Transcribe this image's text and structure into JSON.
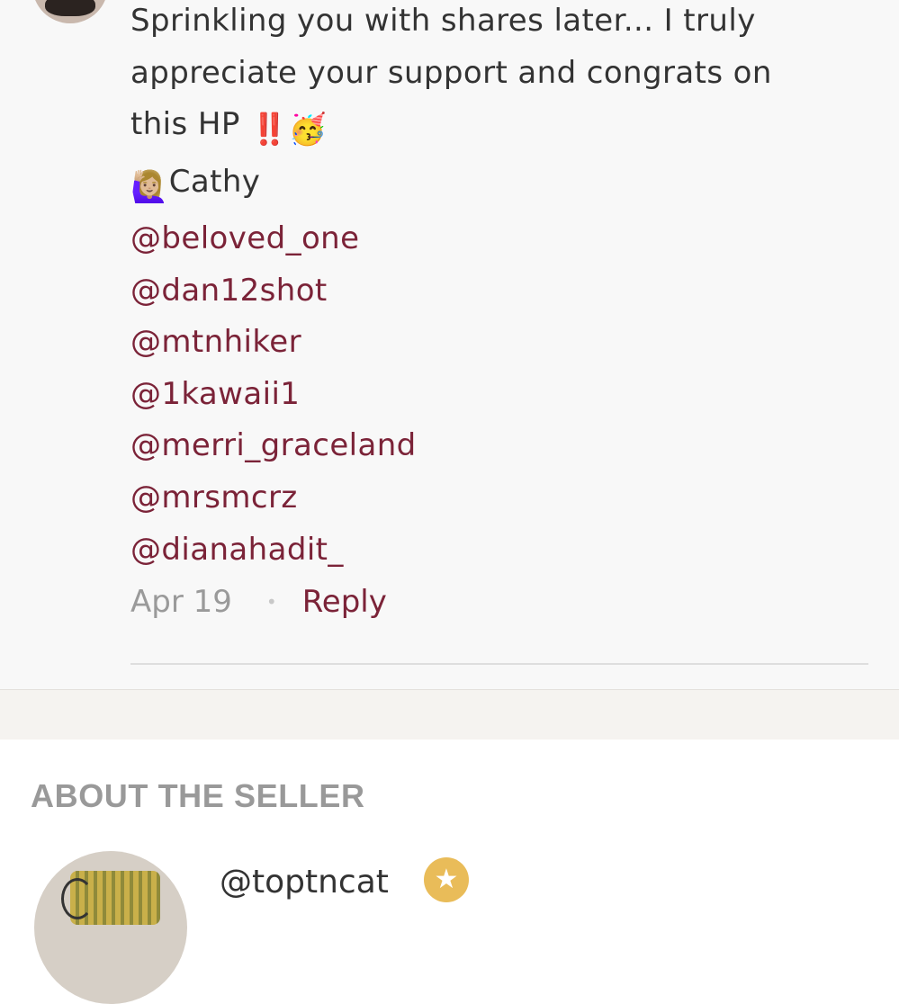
{
  "comment": {
    "line1": "Sprinkling you with shares later... I truly",
    "line2": "appreciate your support and congrats on",
    "line3": "this HP",
    "line3_emoji": "‼️🥳",
    "signoff_emoji": "🙋🏼‍♀️",
    "signoff_name": "Cathy",
    "mentions": [
      "@beloved_one",
      "@dan12shot",
      "@mtnhiker",
      "@1kawaii1",
      "@merri_graceland",
      "@mrsmcrz",
      "@dianahadit_"
    ],
    "date": "Apr 19",
    "separator": "•",
    "reply_label": "Reply"
  },
  "about_seller": {
    "title": "ABOUT THE SELLER",
    "handle": "@toptncat",
    "badge_icon": "star-icon",
    "badge_glyph": "★"
  },
  "colors": {
    "mention": "#7b2338",
    "badge": "#e9bc59",
    "text": "#333333",
    "muted": "#9a9a9a"
  }
}
